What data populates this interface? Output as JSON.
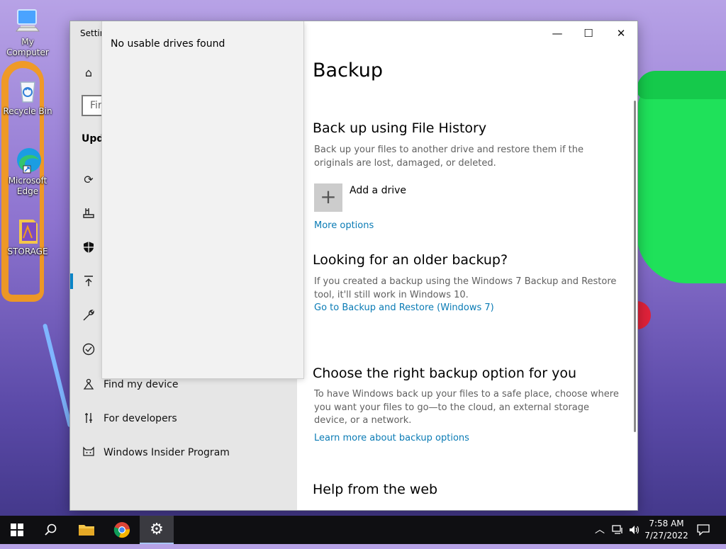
{
  "desktop": {
    "icons": [
      {
        "label": "My Computer"
      },
      {
        "label": "Recycle Bin"
      },
      {
        "label": "Microsoft Edge"
      },
      {
        "label": "STORAGE"
      }
    ]
  },
  "window": {
    "title": "Settin",
    "controls": {
      "minimize": "—",
      "maximize": "☐",
      "close": "✕"
    }
  },
  "nav": {
    "search_placeholder": "Fir",
    "section_title": "Upd",
    "items": [
      {
        "label": "Find my device"
      },
      {
        "label": "For developers"
      },
      {
        "label": "Windows Insider Program"
      }
    ]
  },
  "dropdown": {
    "message": "No usable drives found"
  },
  "content": {
    "title": "Backup",
    "file_history": {
      "heading": "Back up using File History",
      "description": "Back up your files to another drive and restore them if the originals are lost, damaged, or deleted.",
      "add_drive": "Add a drive",
      "more_options": "More options"
    },
    "older_backup": {
      "heading": "Looking for an older backup?",
      "description": "If you created a backup using the Windows 7 Backup and Restore tool, it'll still work in Windows 10.",
      "link": "Go to Backup and Restore (Windows 7)"
    },
    "choose_option": {
      "heading": "Choose the right backup option for you",
      "description": "To have Windows back up your files to a safe place, choose where you want your files to go—to the cloud, an external storage device, or a network.",
      "link": "Learn more about backup options"
    },
    "help": {
      "heading": "Help from the web"
    }
  },
  "taskbar": {
    "time": "7:58 AM",
    "date": "7/27/2022"
  },
  "colors": {
    "accent": "#0b84c7",
    "link": "#0a7bb5"
  }
}
